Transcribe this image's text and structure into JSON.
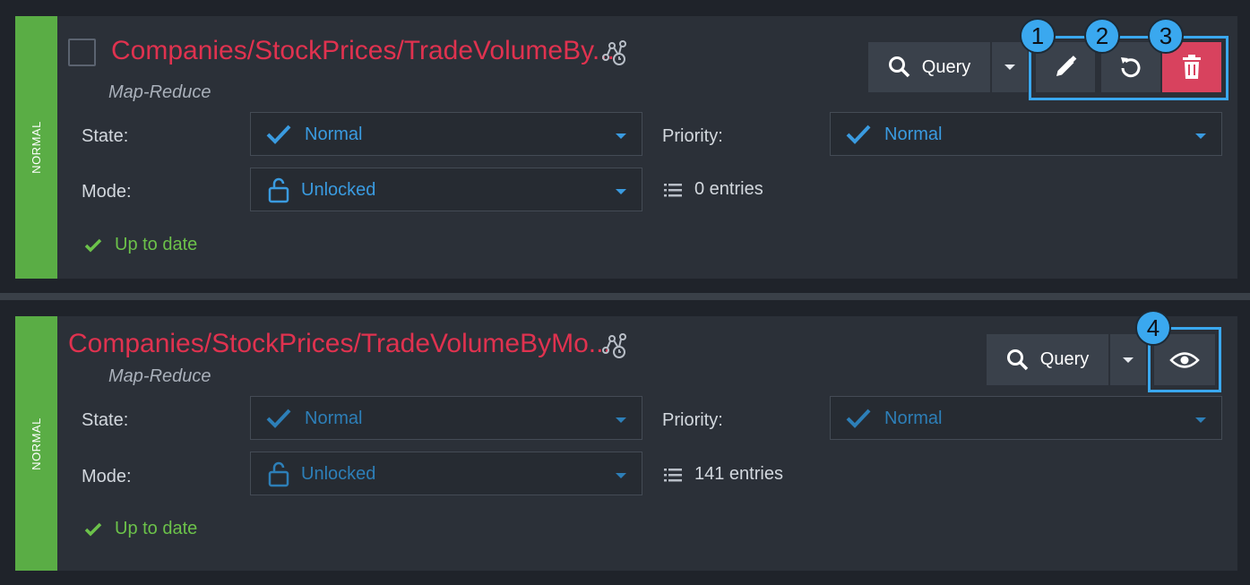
{
  "indexes": [
    {
      "state_strip": "NORMAL",
      "title": "Companies/StockPrices/TradeVolumeBy...",
      "type": "Map-Reduce",
      "state_label": "State:",
      "state_value": "Normal",
      "priority_label": "Priority:",
      "priority_value": "Normal",
      "mode_label": "Mode:",
      "mode_value": "Unlocked",
      "entries": "0 entries",
      "status": "Up to date",
      "query_label": "Query"
    },
    {
      "state_strip": "NORMAL",
      "title": "Companies/StockPrices/TradeVolumeByMo...",
      "type": "Map-Reduce",
      "state_label": "State:",
      "state_value": "Normal",
      "priority_label": "Priority:",
      "priority_value": "Normal",
      "mode_label": "Mode:",
      "mode_value": "Unlocked",
      "entries": "141 entries",
      "status": "Up to date",
      "query_label": "Query"
    }
  ],
  "callouts": [
    "1",
    "2",
    "3",
    "4"
  ],
  "colors": {
    "accent_blue": "#3a9be0",
    "title_red": "#e0324f",
    "status_green": "#6cc24a",
    "strip_green": "#5aad45",
    "delete_red": "#d8425e"
  }
}
